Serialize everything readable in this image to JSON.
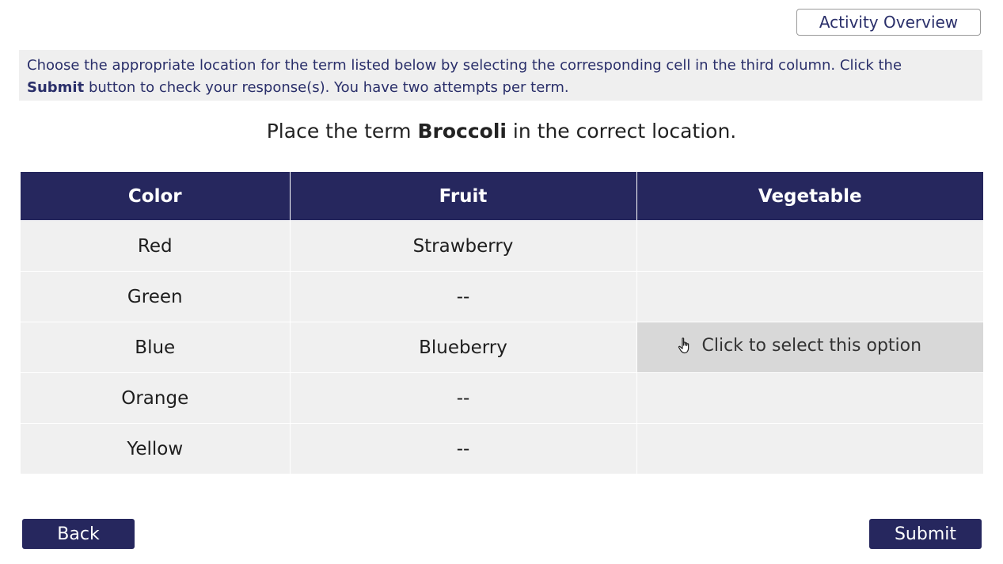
{
  "header": {
    "overview_label": "Activity Overview"
  },
  "instructions": {
    "part1": "Choose the appropriate location for the term listed below by selecting the corresponding cell in the third column. Click the",
    "bold": "Submit",
    "part2": "button to check your response(s). You have two attempts per term."
  },
  "prompt": {
    "before": "Place the term",
    "term": "Broccoli",
    "after": "in the correct location."
  },
  "table": {
    "headers": [
      "Color",
      "Fruit",
      "Vegetable"
    ],
    "rows": [
      {
        "color": "Red",
        "fruit": "Strawberry",
        "vegetable": ""
      },
      {
        "color": "Green",
        "fruit": "--",
        "vegetable": ""
      },
      {
        "color": "Blue",
        "fruit": "Blueberry",
        "vegetable": ""
      },
      {
        "color": "Orange",
        "fruit": "--",
        "vegetable": ""
      },
      {
        "color": "Yellow",
        "fruit": "--",
        "vegetable": ""
      }
    ],
    "hover_hint": "Click to select this option"
  },
  "footer": {
    "back_label": "Back",
    "submit_label": "Submit"
  }
}
